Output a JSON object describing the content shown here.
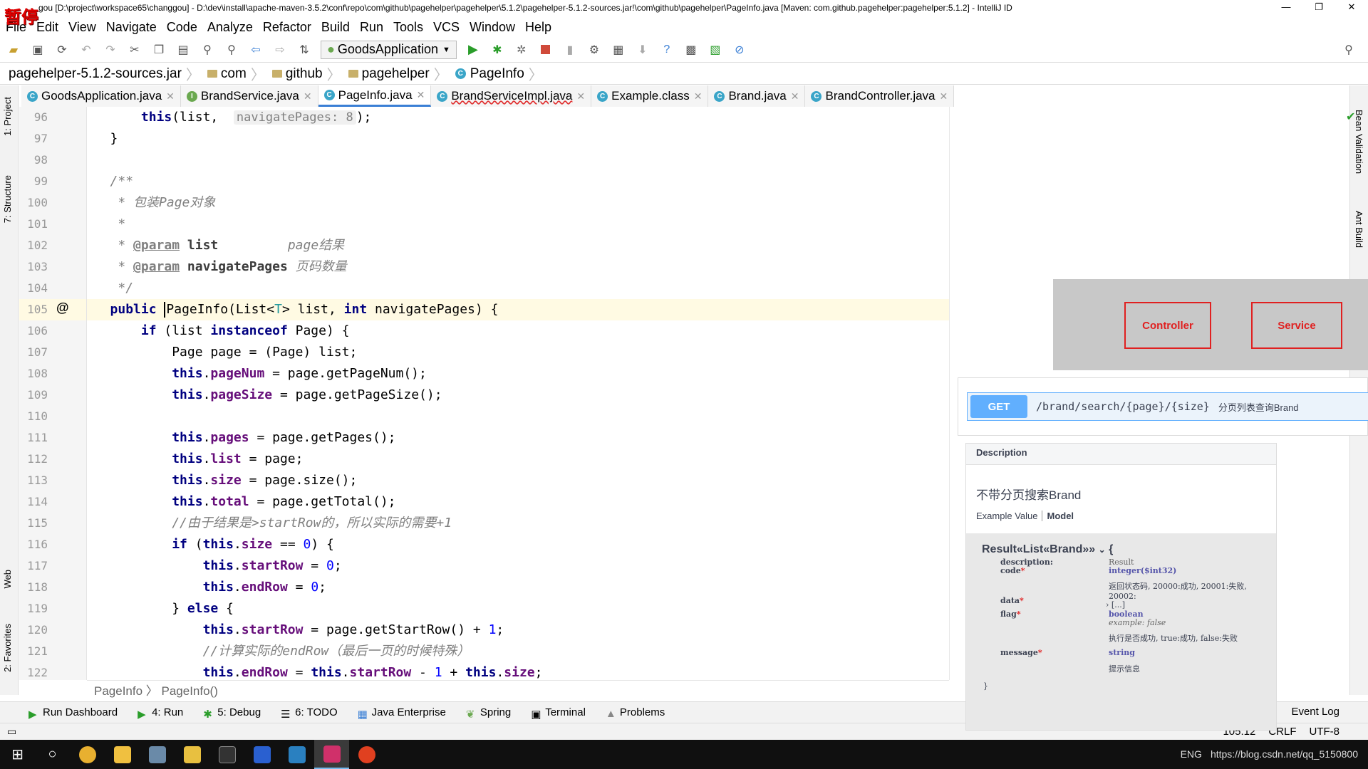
{
  "window": {
    "paused_label": "暂停",
    "title": "gou [D:\\project\\workspace65\\changgou] - D:\\dev\\install\\apache-maven-3.5.2\\conf\\repo\\com\\github\\pagehelper\\pagehelper\\5.1.2\\pagehelper-5.1.2-sources.jar!\\com\\github\\pagehelper\\PageInfo.java [Maven: com.github.pagehelper:pagehelper:5.1.2] - IntelliJ ID",
    "minimize": "—",
    "maximize": "❐",
    "close": "✕"
  },
  "menu": [
    "File",
    "Edit",
    "View",
    "Navigate",
    "Code",
    "Analyze",
    "Refactor",
    "Build",
    "Run",
    "Tools",
    "VCS",
    "Window",
    "Help"
  ],
  "toolbar": {
    "run_config": "GoodsApplication"
  },
  "breadcrumbs": [
    "pagehelper-5.1.2-sources.jar",
    "com",
    "github",
    "pagehelper",
    "PageInfo"
  ],
  "tabs": [
    {
      "label": "GoodsApplication.java",
      "icon": "C",
      "color": "#3aa5c8"
    },
    {
      "label": "BrandService.java",
      "icon": "I",
      "color": "#6aa84f"
    },
    {
      "label": "PageInfo.java",
      "icon": "C",
      "color": "#3aa5c8"
    },
    {
      "label": "BrandServiceImpl.java",
      "icon": "C",
      "color": "#3aa5c8"
    },
    {
      "label": "Example.class",
      "icon": "C",
      "color": "#3aa5c8"
    },
    {
      "label": "Brand.java",
      "icon": "C",
      "color": "#3aa5c8"
    },
    {
      "label": "BrandController.java",
      "icon": "C",
      "color": "#3aa5c8"
    }
  ],
  "left_tools": [
    "1: Project",
    "7: Structure",
    "Web",
    "2: Favorites"
  ],
  "right_tools": [
    "Bean Validation",
    "Ant Build"
  ],
  "line_numbers": [
    "96",
    "97",
    "98",
    "99",
    "100",
    "101",
    "102",
    "103",
    "104",
    "105",
    "106",
    "107",
    "108",
    "109",
    "110",
    "111",
    "112",
    "113",
    "114",
    "115",
    "116",
    "117",
    "118",
    "119",
    "120",
    "121",
    "122"
  ],
  "code": {
    "hint_navigate": "navigatePages: 8",
    "doc_title": "* 包装Page对象",
    "doc_param": "@param",
    "doc_list_desc": "page结果",
    "doc_nav_desc": "页码数量",
    "comment_start_row": "//由于结果是>startRow的，所以实际的需要+1",
    "comment_end_row": "//计算实际的endRow（最后一页的时候特殊）"
  },
  "editor_breadcrumb": "PageInfo  〉 PageInfo()",
  "bottom_tools": [
    "Run Dashboard",
    "4: Run",
    "5: Debug",
    "6: TODO",
    "Java Enterprise",
    "Spring",
    "Terminal",
    "Problems"
  ],
  "event_log": "Event Log",
  "status": {
    "position": "105:12",
    "line_sep": "CRLF",
    "encoding": "UTF-8"
  },
  "taskbar": {
    "url_text": "https://blog.csdn.net/qq_5150800",
    "lang": "ENG"
  },
  "diagram": {
    "controller": "Controller",
    "service": "Service"
  },
  "swagger": {
    "method": "GET",
    "path": "/brand/search/{page}/{size}",
    "summary": "分页列表查询Brand",
    "description_header": "Description",
    "description": "不带分页搜索Brand",
    "tab_example": "Example Value",
    "tab_model": "Model",
    "model_title": "Result«List«Brand»»",
    "fields": {
      "description_key": "description:",
      "description_val": "Result",
      "code_key": "code",
      "code_type": "integer($int32)",
      "code_desc": "返回状态码, 20000:成功, 20001:失败, 20002:",
      "data_key": "data",
      "data_val": "[...]",
      "flag_key": "flag",
      "flag_type": "boolean",
      "flag_example": "example: false",
      "flag_desc": "执行是否成功, true:成功, false:失败",
      "message_key": "message",
      "message_type": "string",
      "message_desc": "提示信息",
      "close_brace": "}"
    }
  }
}
